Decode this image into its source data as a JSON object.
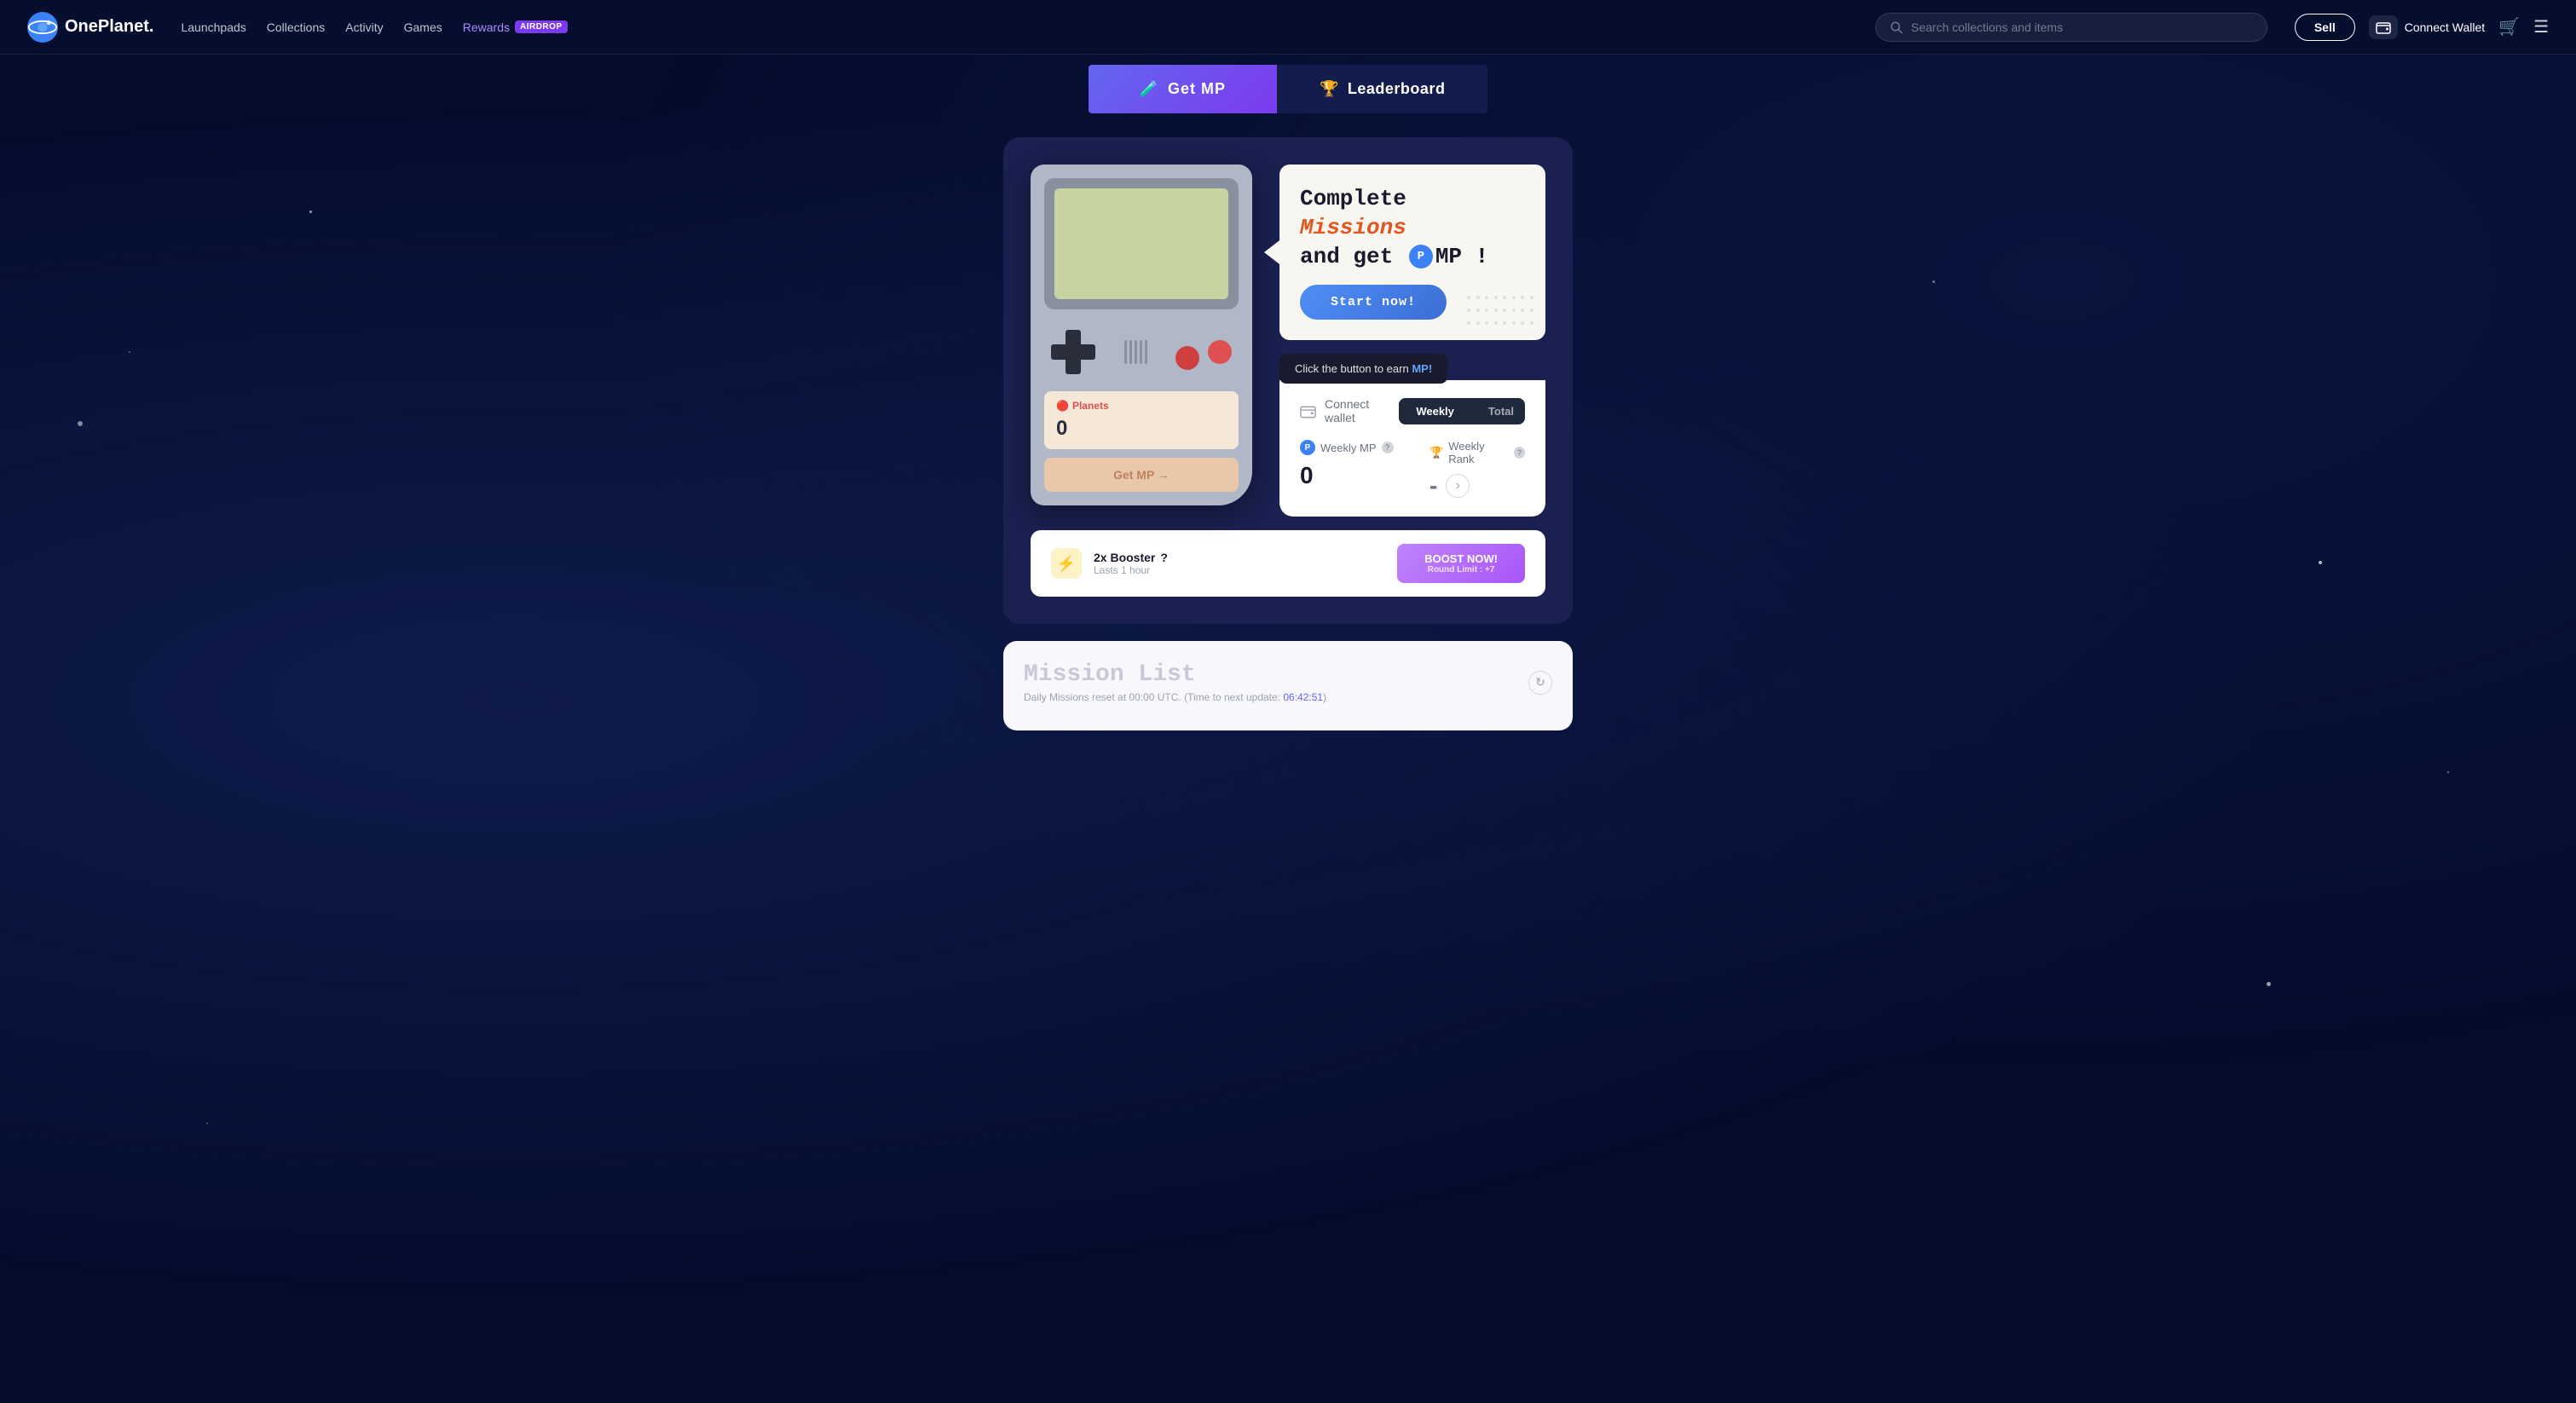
{
  "nav": {
    "logo_text": "OnePlanet.",
    "links": [
      {
        "id": "launchpads",
        "label": "Launchpads"
      },
      {
        "id": "collections",
        "label": "Collections"
      },
      {
        "id": "activity",
        "label": "Activity"
      },
      {
        "id": "games",
        "label": "Games"
      },
      {
        "id": "rewards",
        "label": "Rewards"
      },
      {
        "id": "airdrop",
        "label": "AIRDROP"
      }
    ],
    "search_placeholder": "Search collections and items",
    "sell_label": "Sell",
    "connect_wallet_label": "Connect Wallet"
  },
  "hero": {
    "get_mp_label": "Get MP",
    "leaderboard_label": "Leaderboard"
  },
  "mission": {
    "title_line1": "Complete ",
    "missions_highlight": "Missions",
    "title_line2": "and get ",
    "mp_suffix": "MP !",
    "start_now_label": "Start now!",
    "tooltip": "Click the button to earn ",
    "tooltip_mp": "MP!"
  },
  "gameboy": {
    "planets_label": "Planets",
    "planets_value": "0",
    "get_mp_label": "Get MP →"
  },
  "stats": {
    "connect_wallet_label": "Connect wallet",
    "tab_weekly": "Weekly",
    "tab_total": "Total",
    "weekly_mp_label": "Weekly MP",
    "weekly_rank_label": "Weekly Rank",
    "weekly_mp_value": "0",
    "weekly_rank_value": "-"
  },
  "booster": {
    "title": "2x Booster",
    "duration": "Lasts 1 hour",
    "boost_now_label": "BOOST NOW!",
    "boost_limit": "Round Limit : +7"
  },
  "mission_list": {
    "title": "Mission List",
    "subtitle": "Daily Missions reset at 00:00 UTC. (Time to next update: ",
    "time": "06:42:51",
    "subtitle_end": ")"
  }
}
